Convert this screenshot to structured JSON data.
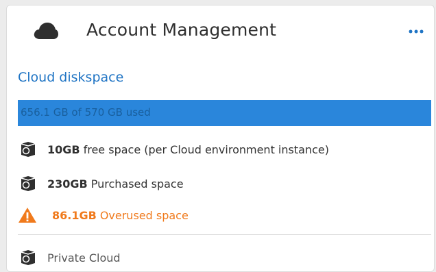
{
  "header": {
    "title": "Account Management",
    "cloud_icon": "cloud-icon",
    "more_icon": "more-horizontal-icon"
  },
  "diskspace": {
    "section_title": "Cloud diskspace",
    "usage_text": "656.1 GB of 570 GB used",
    "usage_fraction": 1.0,
    "free": {
      "value": "10GB",
      "label": "free space (per Cloud environment instance)",
      "icon": "database-icon"
    },
    "purchased": {
      "value": "230GB",
      "label": "Purchased space",
      "icon": "database-icon"
    },
    "overused": {
      "value": "86.1GB",
      "label": "Overused space",
      "icon": "warning-icon"
    }
  },
  "private_cloud": {
    "label": "Private Cloud",
    "icon": "database-icon"
  },
  "colors": {
    "accent_blue": "#1f74c4",
    "bar_fill": "#2a86db",
    "warning_orange": "#f07a1c"
  }
}
